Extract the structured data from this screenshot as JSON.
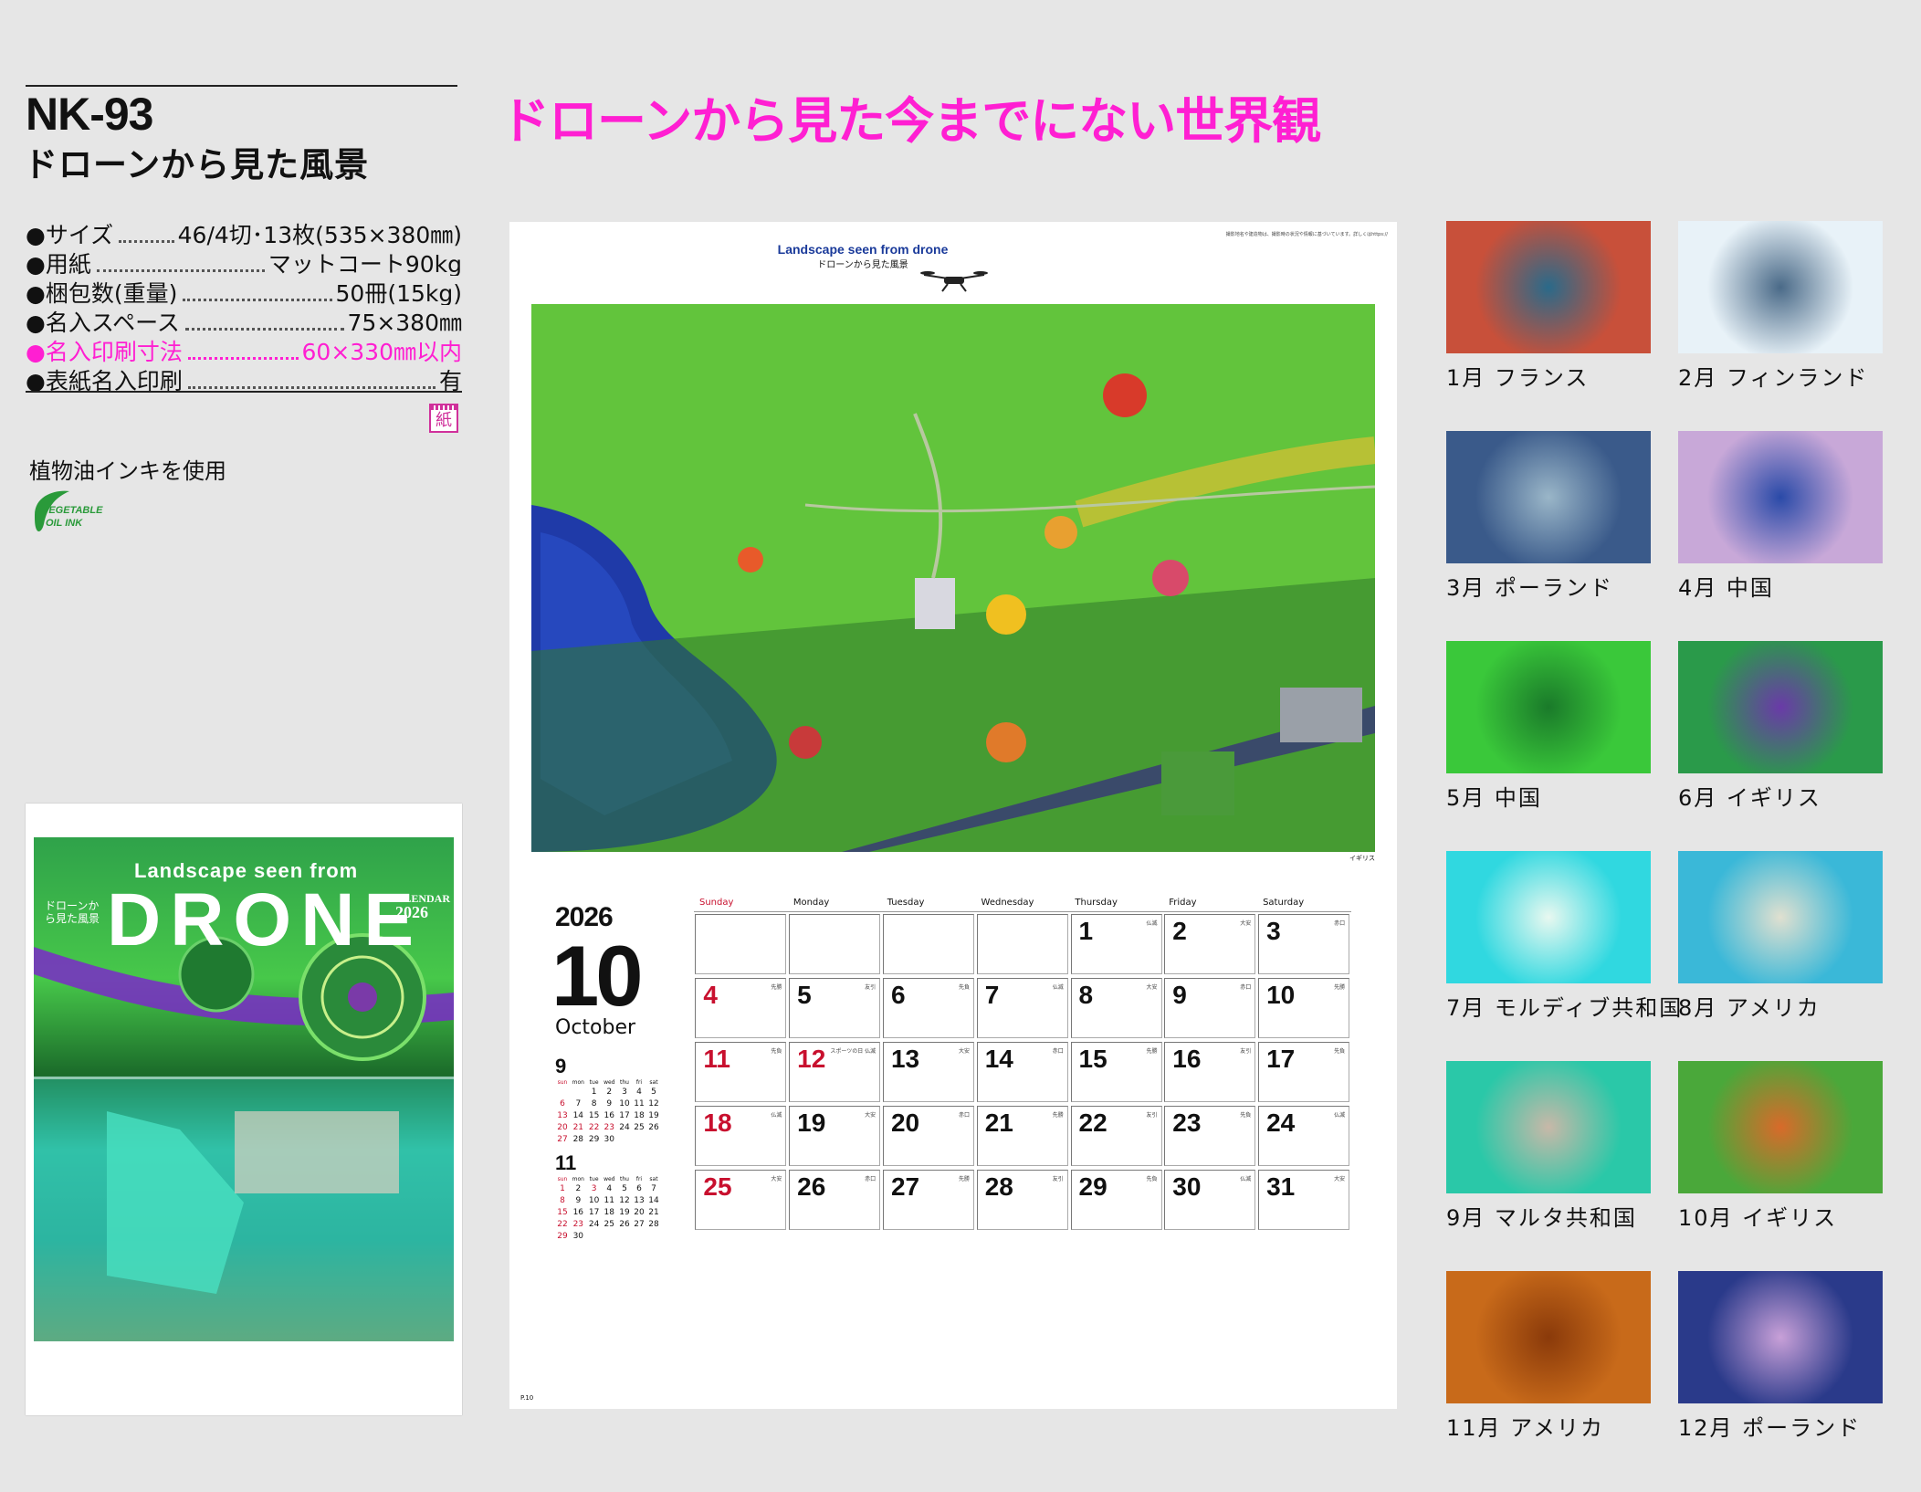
{
  "header": {
    "code": "NK-93",
    "product_title": "ドローンから見た風景",
    "headline": "ドローンから見た今までにない世界観"
  },
  "specs": [
    {
      "label": "●サイズ",
      "value": "46/4切･13枚(535×380㎜)",
      "highlight": false
    },
    {
      "label": "●用紙",
      "value": "マットコート90kg",
      "highlight": false
    },
    {
      "label": "●梱包数(重量)",
      "value": "50冊(15kg)",
      "highlight": false
    },
    {
      "label": "●名入スペース",
      "value": "75×380㎜",
      "highlight": false
    },
    {
      "label": "●名入印刷寸法",
      "value": "60×330㎜以内",
      "highlight": true
    },
    {
      "label": "●表紙名入印刷",
      "value": "有",
      "highlight": false
    }
  ],
  "paper_mark": "紙",
  "veg_ink": {
    "note": "植物油インキを使用",
    "logo_line1": "VEGETABLE",
    "logo_line2": "OIL INK"
  },
  "cover": {
    "subtitle": "Landscape seen from",
    "main_title": "DRONE",
    "calendar_word": "CALENDAR",
    "year": "2026",
    "ja_title": "ドローンから見た風景"
  },
  "page": {
    "title_en": "Landscape seen from drone",
    "title_ja": "ドローンから見た風景",
    "note": "撮影地名や建造物は、撮影時の状況や情報に基づいています。詳しくはhttps://",
    "photo_caption": "イギリス",
    "year": "2026",
    "month_num": "10",
    "month_en": "October",
    "page_number": "P.10",
    "day_headers": [
      "Sunday",
      "Monday",
      "Tuesday",
      "Wednesday",
      "Thursday",
      "Friday",
      "Saturday"
    ],
    "weeks": [
      [
        {
          "d": "",
          "r": ""
        },
        {
          "d": "",
          "r": ""
        },
        {
          "d": "",
          "r": ""
        },
        {
          "d": "",
          "r": ""
        },
        {
          "d": "1",
          "r": "仏滅"
        },
        {
          "d": "2",
          "r": "大安"
        },
        {
          "d": "3",
          "r": "赤口"
        }
      ],
      [
        {
          "d": "4",
          "r": "先勝",
          "red": true
        },
        {
          "d": "5",
          "r": "友引"
        },
        {
          "d": "6",
          "r": "先負"
        },
        {
          "d": "7",
          "r": "仏滅"
        },
        {
          "d": "8",
          "r": "大安"
        },
        {
          "d": "9",
          "r": "赤口"
        },
        {
          "d": "10",
          "r": "先勝"
        }
      ],
      [
        {
          "d": "11",
          "r": "先負",
          "red": true
        },
        {
          "d": "12",
          "r": "スポーツの日 仏滅",
          "red": true
        },
        {
          "d": "13",
          "r": "大安"
        },
        {
          "d": "14",
          "r": "赤口"
        },
        {
          "d": "15",
          "r": "先勝"
        },
        {
          "d": "16",
          "r": "友引"
        },
        {
          "d": "17",
          "r": "先負"
        }
      ],
      [
        {
          "d": "18",
          "r": "仏滅",
          "red": true
        },
        {
          "d": "19",
          "r": "大安"
        },
        {
          "d": "20",
          "r": "赤口"
        },
        {
          "d": "21",
          "r": "先勝"
        },
        {
          "d": "22",
          "r": "友引"
        },
        {
          "d": "23",
          "r": "先負"
        },
        {
          "d": "24",
          "r": "仏滅"
        }
      ],
      [
        {
          "d": "25",
          "r": "大安",
          "red": true
        },
        {
          "d": "26",
          "r": "赤口"
        },
        {
          "d": "27",
          "r": "先勝"
        },
        {
          "d": "28",
          "r": "友引"
        },
        {
          "d": "29",
          "r": "先負"
        },
        {
          "d": "30",
          "r": "仏滅"
        },
        {
          "d": "31",
          "r": "大安"
        }
      ]
    ],
    "mini_cals": [
      {
        "month": "9",
        "header": [
          "sun",
          "mon",
          "tue",
          "wed",
          "thu",
          "fri",
          "sat"
        ],
        "rows": [
          [
            "",
            "",
            "1",
            "2",
            "3",
            "4",
            "5"
          ],
          [
            "6",
            "7",
            "8",
            "9",
            "10",
            "11",
            "12"
          ],
          [
            "13",
            "14",
            "15",
            "16",
            "17",
            "18",
            "19"
          ],
          [
            "20",
            "21",
            "22",
            "23",
            "24",
            "25",
            "26"
          ],
          [
            "27",
            "28",
            "29",
            "30",
            "",
            "",
            ""
          ]
        ],
        "red": [
          "6",
          "13",
          "20",
          "27",
          "21",
          "22",
          "23"
        ]
      },
      {
        "month": "11",
        "header": [
          "sun",
          "mon",
          "tue",
          "wed",
          "thu",
          "fri",
          "sat"
        ],
        "rows": [
          [
            "1",
            "2",
            "3",
            "4",
            "5",
            "6",
            "7"
          ],
          [
            "8",
            "9",
            "10",
            "11",
            "12",
            "13",
            "14"
          ],
          [
            "15",
            "16",
            "17",
            "18",
            "19",
            "20",
            "21"
          ],
          [
            "22",
            "23",
            "24",
            "25",
            "26",
            "27",
            "28"
          ],
          [
            "29",
            "30",
            "",
            "",
            "",
            "",
            ""
          ]
        ],
        "red": [
          "1",
          "3",
          "8",
          "15",
          "22",
          "23",
          "29"
        ]
      }
    ]
  },
  "thumbnails": [
    {
      "label": "1月 フランス",
      "c1": "#c8503a",
      "c2": "#2a6a8a"
    },
    {
      "label": "2月 フィンランド",
      "c1": "#e8f2f8",
      "c2": "#4a6a88"
    },
    {
      "label": "3月 ポーランド",
      "c1": "#3a5a8a",
      "c2": "#9ab6c8"
    },
    {
      "label": "4月 中国",
      "c1": "#c8a8d8",
      "c2": "#2a4aa8"
    },
    {
      "label": "5月 中国",
      "c1": "#3ac83a",
      "c2": "#1a7a2a"
    },
    {
      "label": "6月 イギリス",
      "c1": "#2a9a4a",
      "c2": "#6a3aa8"
    },
    {
      "label": "7月 モルディブ共和国",
      "c1": "#30d8e0",
      "c2": "#e8f8f0"
    },
    {
      "label": "8月 アメリカ",
      "c1": "#3ab8d8",
      "c2": "#e0e0d0"
    },
    {
      "label": "9月 マルタ共和国",
      "c1": "#2ac8a8",
      "c2": "#c8b8a8"
    },
    {
      "label": "10月 イギリス",
      "c1": "#4aa83a",
      "c2": "#d86a2a"
    },
    {
      "label": "11月 アメリカ",
      "c1": "#c86a1a",
      "c2": "#8a3a0a"
    },
    {
      "label": "12月 ポーランド",
      "c1": "#2a3a8a",
      "c2": "#c8a0d8"
    }
  ]
}
